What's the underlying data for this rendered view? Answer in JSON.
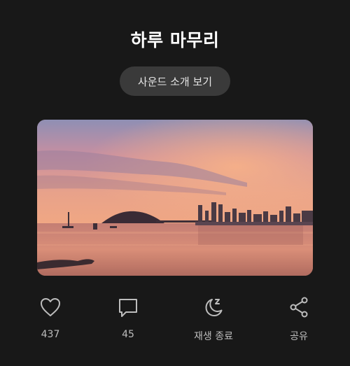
{
  "header": {
    "title": "하루 마무리",
    "sound_button_label": "사운드 소개 보기"
  },
  "hero": {
    "description": "sunset-over-harbor-city"
  },
  "actions": [
    {
      "icon": "heart-icon",
      "label": "437"
    },
    {
      "icon": "comment-icon",
      "label": "45"
    },
    {
      "icon": "moon-sleep-icon",
      "label": "재생 종료"
    },
    {
      "icon": "share-icon",
      "label": "공유"
    }
  ],
  "colors": {
    "background": "#181818",
    "button_bg": "#3a3a3a",
    "label": "#bdbdbd"
  }
}
